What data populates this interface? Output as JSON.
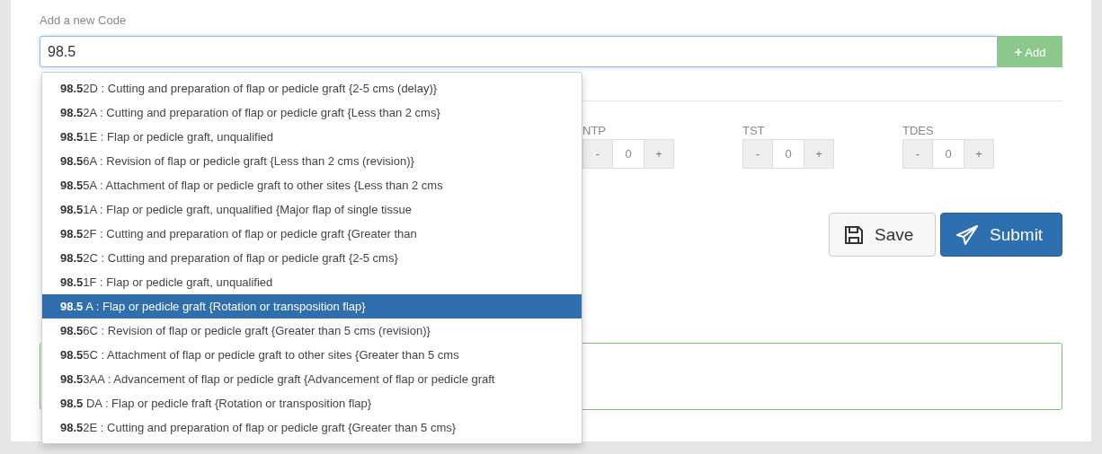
{
  "code_field": {
    "label": "Add a new Code",
    "value": "98.5"
  },
  "add_button": {
    "icon": "+",
    "label": "Add"
  },
  "suggestions": [
    {
      "text": "**98.5**2D : Cutting and preparation of flap or pedicle graft {2-5 cms (delay)}",
      "selected": false
    },
    {
      "text": "**98.5**2A : Cutting and preparation of flap or pedicle graft {Less than 2 cms}",
      "selected": false
    },
    {
      "text": "**98.5**1E : Flap or pedicle graft, unqualified",
      "selected": false
    },
    {
      "text": "**98.5**6A : Revision of flap or pedicle graft {Less than 2 cms (revision)}",
      "selected": false
    },
    {
      "text": "**98.5**5A : Attachment of flap or pedicle graft to other sites {Less than 2 cms",
      "selected": false
    },
    {
      "text": "**98.5**1A : Flap or pedicle graft, unqualified {Major flap of single tissue",
      "selected": false
    },
    {
      "text": "**98.5**2F : Cutting and preparation of flap or pedicle graft {Greater than",
      "selected": false
    },
    {
      "text": "**98.5**2C : Cutting and preparation of flap or pedicle graft {2-5 cms}",
      "selected": false
    },
    {
      "text": "**98.5**1F : Flap or pedicle graft, unqualified",
      "selected": false
    },
    {
      "text": "**98.5** A : Flap or pedicle graft {Rotation or transposition flap}",
      "selected": true
    },
    {
      "text": "**98.5**6C : Revision of flap or pedicle graft {Greater than 5 cms (revision)}",
      "selected": false
    },
    {
      "text": "**98.5**5C : Attachment of flap or pedicle graft to other sites {Greater than 5 cms",
      "selected": false
    },
    {
      "text": "**98.5**3AA : Advancement of flap or pedicle graft {Advancement of flap or pedicle graft",
      "selected": false
    },
    {
      "text": "**98.5** DA : Flap or pedicle fraft {Rotation or transposition flap}",
      "selected": false
    },
    {
      "text": "**98.5**2E : Cutting and preparation of flap or pedicle graft {Greater than 5 cms}",
      "selected": false
    }
  ],
  "counters": [
    {
      "label": "NTP",
      "minus": "-",
      "value": "0",
      "plus": "+"
    },
    {
      "label": "TST",
      "minus": "-",
      "value": "0",
      "plus": "+"
    },
    {
      "label": "TDES",
      "minus": "-",
      "value": "0",
      "plus": "+"
    }
  ],
  "buttons": [
    {
      "kind": "save",
      "label": "Save"
    },
    {
      "kind": "submit",
      "label": "Submit"
    }
  ]
}
